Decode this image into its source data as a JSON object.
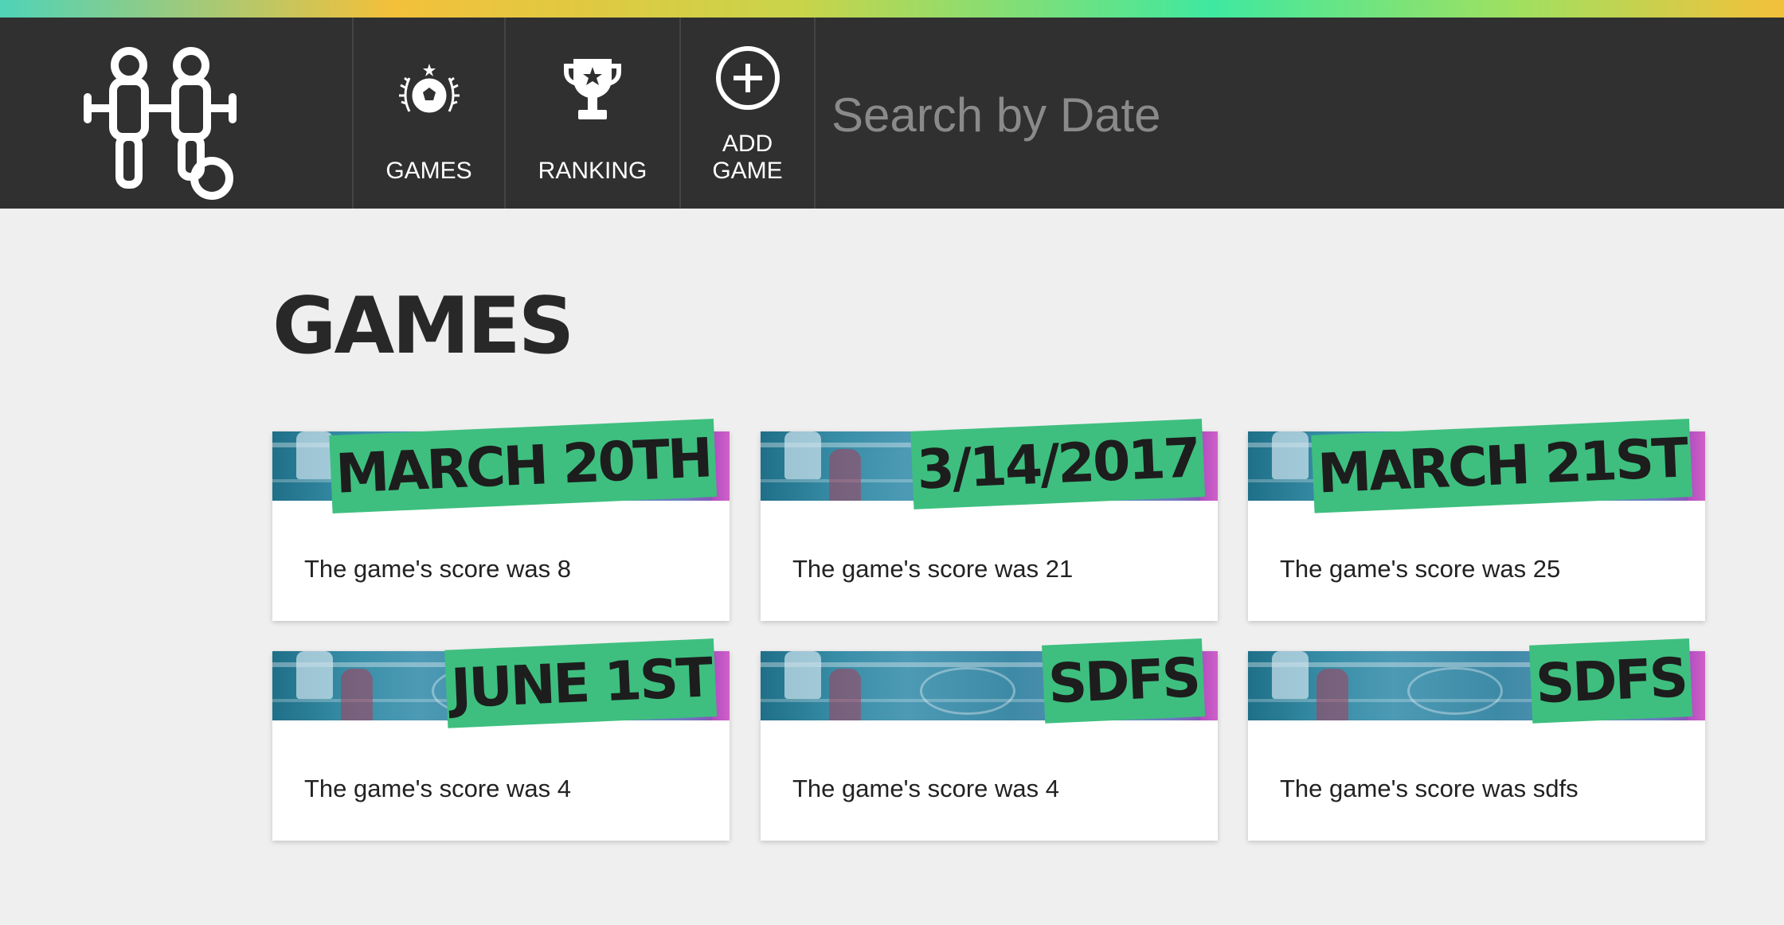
{
  "nav": {
    "games_label": "GAMES",
    "ranking_label": "RANKING",
    "add_game_label_line1": "ADD",
    "add_game_label_line2": "GAME"
  },
  "search": {
    "placeholder": "Search by Date"
  },
  "page": {
    "title": "GAMES"
  },
  "games": [
    {
      "date": "MARCH 20TH",
      "score_text": "The game's score was 8"
    },
    {
      "date": "3/14/2017",
      "score_text": "The game's score was 21"
    },
    {
      "date": "MARCH 21ST",
      "score_text": "The game's score was 25"
    },
    {
      "date": "JUNE 1ST",
      "score_text": "The game's score was 4"
    },
    {
      "date": "SDFS",
      "score_text": "The game's score was 4"
    },
    {
      "date": "SDFS",
      "score_text": "The game's score was sdfs"
    }
  ],
  "colors": {
    "navbar_bg": "#303030",
    "accent_green": "#3ebf7f",
    "page_bg": "#efefef"
  }
}
